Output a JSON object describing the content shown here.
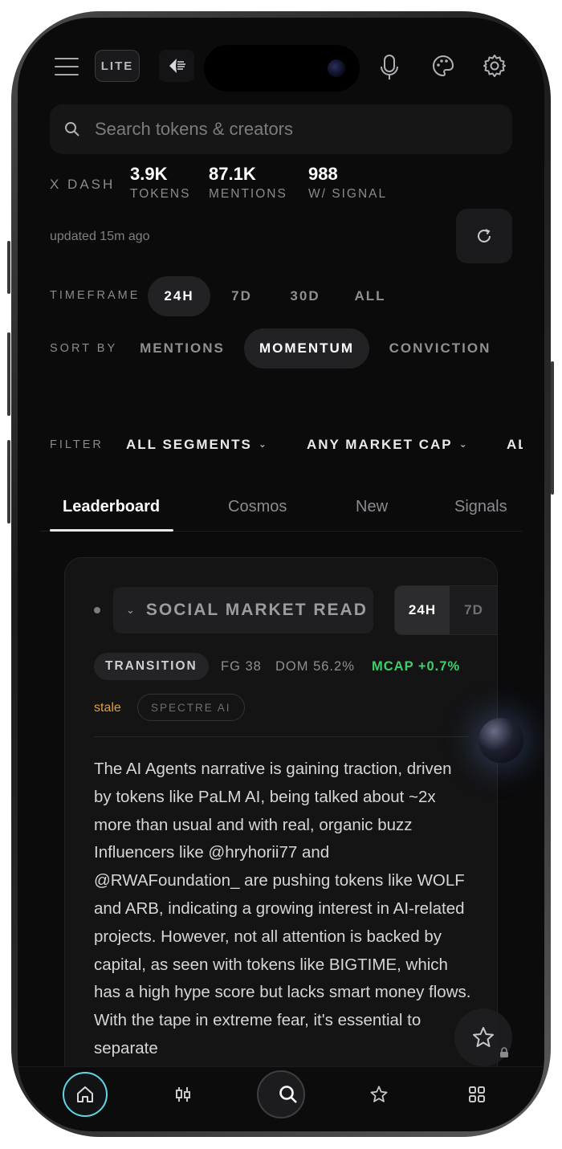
{
  "header": {
    "lite_label": "LITE",
    "icons": [
      "menu-icon",
      "logo-icon",
      "mic-icon",
      "palette-icon",
      "gear-icon"
    ]
  },
  "search": {
    "placeholder": "Search tokens & creators",
    "value": ""
  },
  "stats": {
    "brand": "X DASH",
    "items": [
      {
        "value": "3.9K",
        "label": "TOKENS"
      },
      {
        "value": "87.1K",
        "label": "MENTIONS"
      },
      {
        "value": "988",
        "label": "W/ SIGNAL"
      }
    ],
    "updated": "updated 15m ago"
  },
  "timeframe": {
    "label": "TIMEFRAME",
    "options": [
      "24H",
      "7D",
      "30D",
      "ALL"
    ],
    "selected": "24H"
  },
  "sort": {
    "label": "SORT BY",
    "options": [
      "MENTIONS",
      "MOMENTUM",
      "CONVICTION"
    ],
    "selected": "MOMENTUM"
  },
  "filter": {
    "label": "FILTER",
    "segments": "ALL SEGMENTS",
    "market_cap": "ANY MARKET CAP",
    "more": "AL"
  },
  "tabs": {
    "items": [
      "Leaderboard",
      "Cosmos",
      "New",
      "Signals"
    ],
    "selected": "Leaderboard"
  },
  "card": {
    "title": "SOCIAL MARKET READ",
    "tf_active": "24H",
    "tf_inactive": "7D",
    "regime": "TRANSITION",
    "fg": "FG 38",
    "dom": "DOM 56.2%",
    "mcap": "MCAP +0.7%",
    "stale": "stale",
    "source": "SPECTRE AI",
    "body": "The AI Agents narrative is gaining traction, driven by tokens like PaLM AI, being talked about ~2x more than usual and with real, organic buzz Influencers like @hryhorii77 and @RWAFoundation_ are pushing tokens like WOLF and ARB, indicating a growing interest in AI-related projects. However, not all attention is backed by capital, as seen with tokens like BIGTIME, which has a high hype score but lacks smart money flows. With the tape in extreme fear, it's essential to separate"
  },
  "colors": {
    "background": "#0b0b0c",
    "accent_home": "#5fd5e6",
    "positive": "#3ecf6a",
    "stale": "#e0a13a"
  },
  "bottom_nav": {
    "icons": [
      "home-icon",
      "candlestick-icon",
      "search-icon",
      "star-icon",
      "grid-icon"
    ],
    "selected": "home-icon"
  }
}
